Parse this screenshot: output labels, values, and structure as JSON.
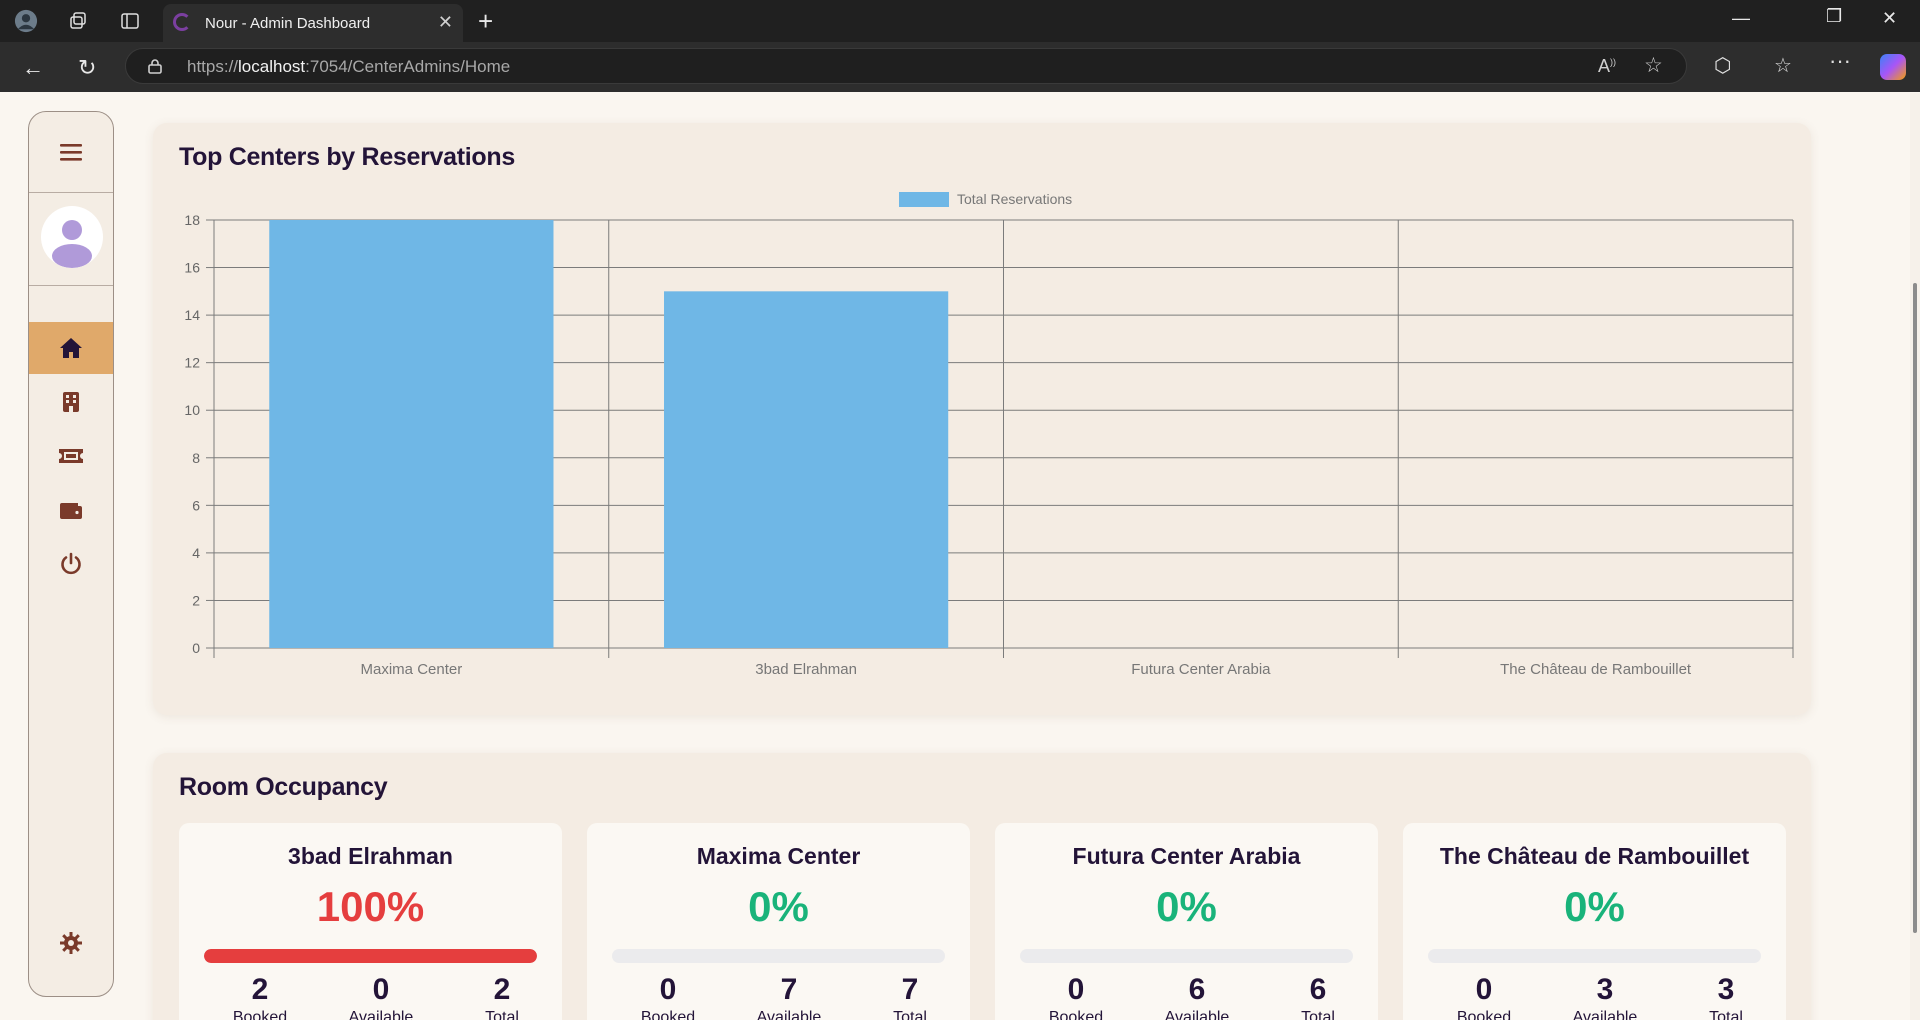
{
  "browser": {
    "tab_title": "Nour - Admin Dashboard",
    "url_scheme": "https://",
    "url_host": "localhost",
    "url_path": ":7054/CenterAdmins/Home"
  },
  "sidebar": {
    "items": [
      {
        "icon": "home-icon",
        "active": true
      },
      {
        "icon": "building-icon",
        "active": false
      },
      {
        "icon": "ticket-icon",
        "active": false
      },
      {
        "icon": "wallet-icon",
        "active": false
      },
      {
        "icon": "power-icon",
        "active": false
      }
    ],
    "settings_icon": "gear-icon"
  },
  "reservations": {
    "title": "Top Centers by Reservations"
  },
  "chart_data": {
    "type": "bar",
    "categories": [
      "Maxima Center",
      "3bad Elrahman",
      "Futura Center Arabia",
      "The Château de Rambouillet"
    ],
    "series": [
      {
        "name": "Total Reservations",
        "values": [
          18,
          15,
          0,
          0
        ],
        "color": "#6fb7e6"
      }
    ],
    "yticks": [
      "0",
      "2",
      "4",
      "6",
      "8",
      "10",
      "12",
      "14",
      "16",
      "18"
    ],
    "ylim": [
      0,
      18
    ],
    "grid": true,
    "legend": "top-center"
  },
  "occupancy": {
    "title": "Room Occupancy",
    "stat_labels": [
      "Booked",
      "Available",
      "Total"
    ],
    "cards": [
      {
        "name": "3bad Elrahman",
        "percent_label": "100%",
        "percent": 100,
        "color": "#e53e3e",
        "booked": "2",
        "available": "0",
        "total": "2"
      },
      {
        "name": "Maxima Center",
        "percent_label": "0%",
        "percent": 0,
        "color": "#19b37a",
        "booked": "0",
        "available": "7",
        "total": "7"
      },
      {
        "name": "Futura Center Arabia",
        "percent_label": "0%",
        "percent": 0,
        "color": "#19b37a",
        "booked": "0",
        "available": "6",
        "total": "6"
      },
      {
        "name": "The Château de Rambouillet",
        "percent_label": "0%",
        "percent": 0,
        "color": "#19b37a",
        "booked": "0",
        "available": "3",
        "total": "3"
      }
    ]
  }
}
